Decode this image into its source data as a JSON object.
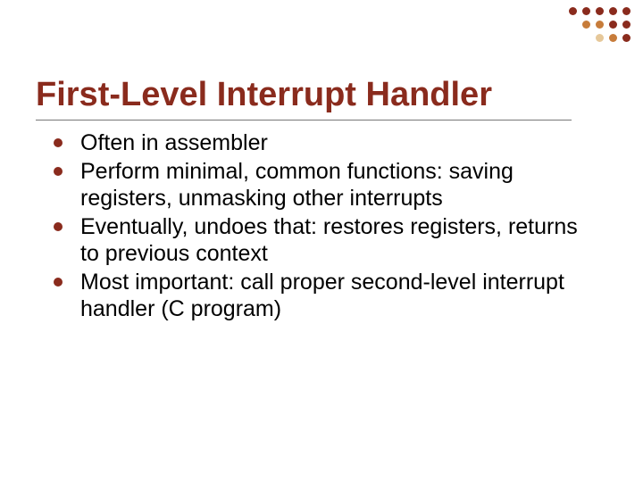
{
  "deco_colors": {
    "dark": "#8a2b1d",
    "mid": "#c77c3a",
    "light": "#e6c89a"
  },
  "title": "First-Level Interrupt Handler",
  "bullets": [
    "Often in assembler",
    "Perform minimal, common functions: saving registers, unmasking other interrupts",
    "Eventually, undoes that: restores registers, returns to previous context",
    "Most important: call proper second-level interrupt handler (C program)"
  ]
}
